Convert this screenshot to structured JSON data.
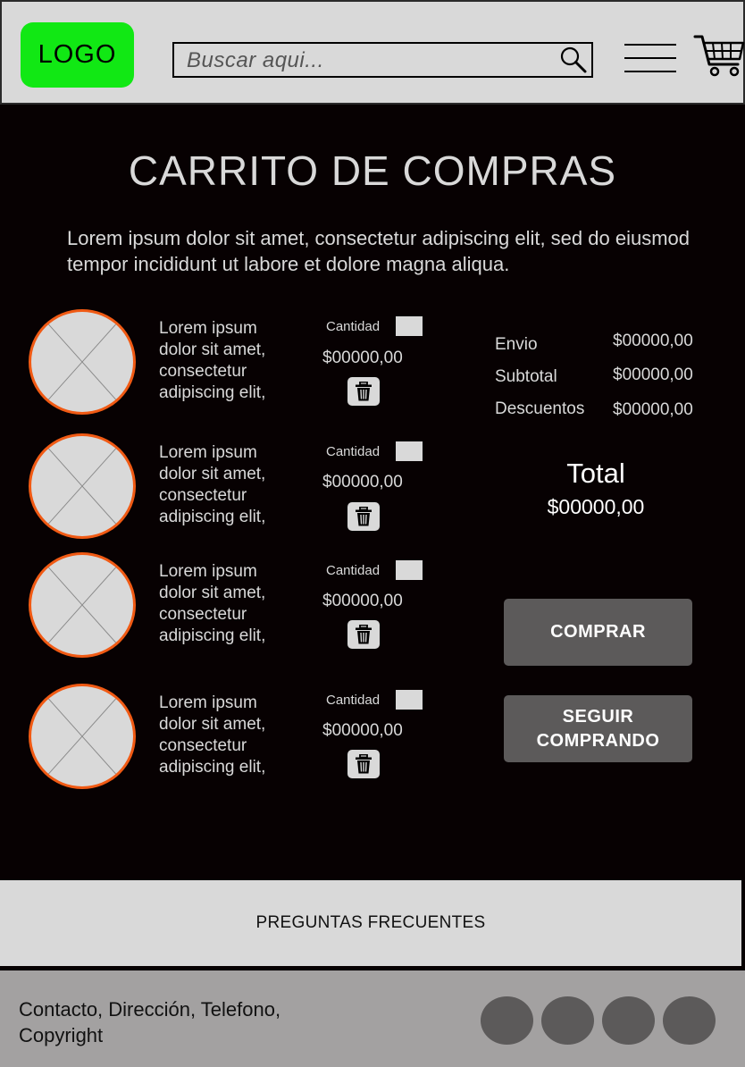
{
  "header": {
    "logo": "LOGO",
    "search_placeholder": "Buscar  aqui..."
  },
  "page": {
    "title": "CARRITO DE COMPRAS",
    "intro": "Lorem ipsum dolor sit amet, consectetur adipiscing elit, sed do eiusmod tempor incididunt ut labore et dolore magna aliqua."
  },
  "cart_items": [
    {
      "description": "Lorem ipsum\ndolor sit amet,\nconsectetur\nadipiscing elit,",
      "qty_label": "Cantidad",
      "price": "$00000,00"
    },
    {
      "description": "Lorem ipsum\ndolor sit amet,\nconsectetur\nadipiscing elit,",
      "qty_label": "Cantidad",
      "price": "$00000,00"
    },
    {
      "description": "Lorem ipsum\ndolor sit amet,\nconsectetur\nadipiscing elit,",
      "qty_label": "Cantidad",
      "price": "$00000,00"
    },
    {
      "description": "Lorem ipsum\ndolor sit amet,\nconsectetur\nadipiscing elit,",
      "qty_label": "Cantidad",
      "price": "$00000,00"
    }
  ],
  "summary": {
    "shipping_label": "Envio",
    "shipping_value": "$00000,00",
    "subtotal_label": "Subtotal",
    "subtotal_value": "$00000,00",
    "discount_label": "Descuentos",
    "discount_value": "$00000,00",
    "total_label": "Total",
    "total_value": "$00000,00"
  },
  "actions": {
    "buy_label": "COMPRAR",
    "continue_label": "SEGUIR\nCOMPRANDO"
  },
  "faq": {
    "label": "PREGUNTAS FRECUENTES"
  },
  "footer": {
    "info": "Contacto, Dirección, Telefono,\nCopyright",
    "social_icons": [
      "social-icon-1",
      "social-icon-2",
      "social-icon-3",
      "social-icon-4"
    ]
  },
  "colors": {
    "background": "#070102",
    "header": "#d9d9d9",
    "logo": "#11e814",
    "thumb_border": "#f05a14",
    "button": "#5c5a5a",
    "footer": "#a3a1a1"
  }
}
